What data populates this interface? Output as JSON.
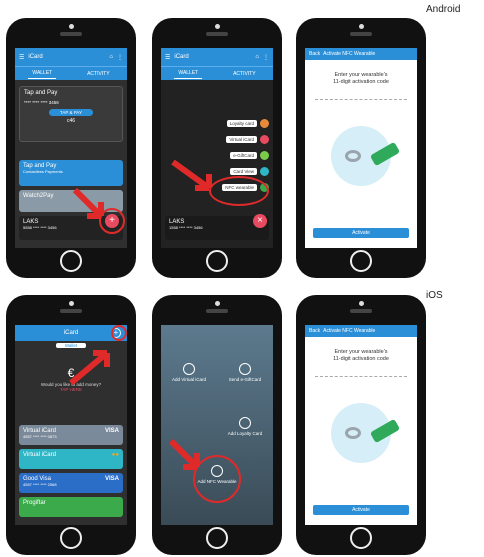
{
  "labels": {
    "android": "Android",
    "ios": "iOS"
  },
  "android": {
    "screen1": {
      "app_title": "iCard",
      "tabs": [
        "WALLET",
        "ACTIVITY"
      ],
      "card_top": {
        "title": "Tap and Pay",
        "number": "**** **** **** 3456",
        "button": "TAP & PAY",
        "balance": "c46"
      },
      "cards": [
        {
          "title": "Tap and Pay",
          "sub": "Contactless Payments"
        },
        {
          "title": "Watch2Pay",
          "sub": ""
        },
        {
          "title": "LAKS",
          "sub": "5558 **** **** 3456"
        }
      ]
    },
    "screen2": {
      "app_title": "iCard",
      "tabs": [
        "WALLET",
        "ACTIVITY"
      ],
      "menu": [
        "Loyalty card",
        "Virtual iCard",
        "e-GiftCard",
        "Card View",
        "NFC wearable"
      ],
      "card_bottom": {
        "title": "LAKS",
        "number": "1558 **** **** 3456"
      }
    },
    "screen3": {
      "back": "Back",
      "title": "Activate NFC Wearable",
      "prompt_line1": "Enter your wearable's",
      "prompt_line2": "11-digit activation code",
      "button": "Activate"
    }
  },
  "ios": {
    "screen1": {
      "app_title": "iCard",
      "wallet": "Wallet",
      "balance": "€",
      "question": "Would you like to add money?",
      "tap_here": "TAP HERE",
      "cards": [
        {
          "title": "Virtual iCard",
          "number": "4557 **** **** 0873",
          "brand": "VISA",
          "color": "#7a8a9a"
        },
        {
          "title": "Virtual iCard",
          "number": "",
          "brand": "MC",
          "color": "#2eb6c6"
        },
        {
          "title": "Good Visa",
          "number": "4557 **** **** 2568",
          "brand": "VISA",
          "color": "#2b6ec8"
        },
        {
          "title": "Progiftar",
          "number": "",
          "brand": "",
          "color": "#3aaa4a"
        }
      ]
    },
    "screen2": {
      "items": [
        {
          "label": "Add Virtual iCard"
        },
        {
          "label": "Send e-GiftCard"
        },
        {
          "label": "Add Loyalty Card"
        },
        {
          "label": "Add NFC Wearable"
        }
      ]
    },
    "screen3": {
      "back": "Back",
      "title": "Activate NFC Wearable",
      "prompt_line1": "Enter your wearable's",
      "prompt_line2": "11-digit activation code",
      "button": "Activate"
    }
  }
}
